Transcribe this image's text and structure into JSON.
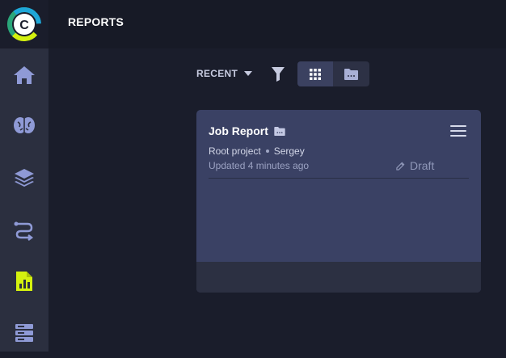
{
  "header": {
    "title": "REPORTS"
  },
  "sidebar": {
    "items": [
      {
        "icon": "home-icon"
      },
      {
        "icon": "brain-icon"
      },
      {
        "icon": "layers-icon"
      },
      {
        "icon": "pipelines-icon"
      },
      {
        "icon": "reports-icon",
        "active": true
      },
      {
        "icon": "server-icon"
      }
    ]
  },
  "toolbar": {
    "sort_label": "RECENT",
    "view_modes": [
      "grid",
      "folder"
    ],
    "active_view": "grid"
  },
  "report_card": {
    "title": "Job Report",
    "project": "Root project",
    "user": "Sergey",
    "updated": "Updated 4 minutes ago",
    "status": "Draft"
  },
  "colors": {
    "accent": "#d4f10f",
    "icon": "#8f9ad6",
    "card_bg": "#3a4164",
    "page_bg": "#1a1d2b"
  }
}
